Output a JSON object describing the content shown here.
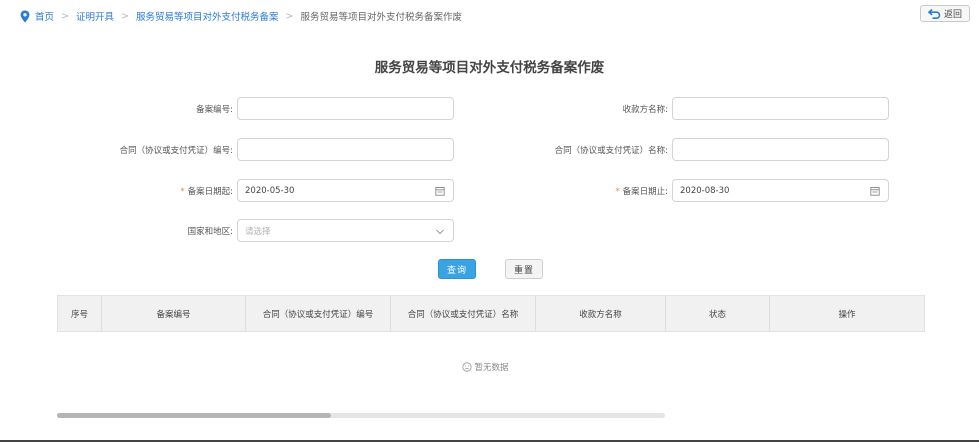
{
  "breadcrumb": {
    "items": [
      "首页",
      "证明开具",
      "服务贸易等项目对外支付税务备案"
    ],
    "current": "服务贸易等项目对外支付税务备案作废",
    "separator": ">"
  },
  "back_button": {
    "label": "返回"
  },
  "page_title": "服务贸易等项目对外支付税务备案作废",
  "form": {
    "record_no": {
      "label": "备案编号:",
      "value": ""
    },
    "payee_name": {
      "label": "收款方名称:",
      "value": ""
    },
    "contract_no": {
      "label": "合同（协议或支付凭证）编号:",
      "value": ""
    },
    "contract_name": {
      "label": "合同（协议或支付凭证）名称:",
      "value": ""
    },
    "date_start": {
      "label": "备案日期起:",
      "value": "2020-05-30",
      "required_mark": "*"
    },
    "date_end": {
      "label": "备案日期止:",
      "value": "2020-08-30",
      "required_mark": "*"
    },
    "country": {
      "label": "国家和地区:",
      "placeholder": "请选择"
    }
  },
  "buttons": {
    "query": "查询",
    "reset": "重置"
  },
  "table": {
    "columns": [
      "序号",
      "备案编号",
      "合同（协议或支付凭证）编号",
      "合同（协议或支付凭证）名称",
      "收款方名称",
      "状态",
      "操作"
    ],
    "empty_text": "暂无数据"
  },
  "colors": {
    "link": "#2a7ad6",
    "primary_button": "#3aa3e3",
    "required": "#f08a3a"
  },
  "scroll": {
    "horizontal_thumb_fraction": 0.45
  }
}
